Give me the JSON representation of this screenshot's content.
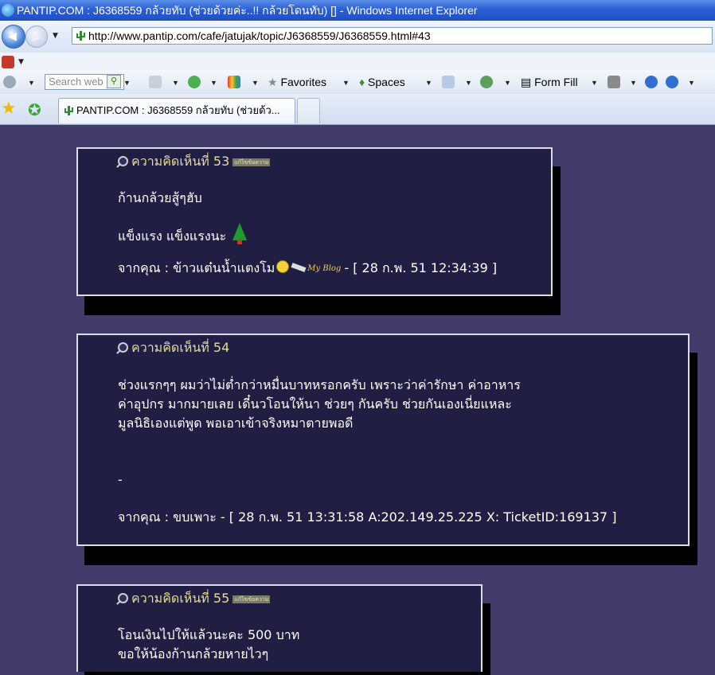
{
  "window": {
    "title": "PANTIP.COM : J6368559 กล้วยทับ (ช่วยด้วยค่ะ..!! กล้วยโดนทับ) [] - Windows Internet Explorer"
  },
  "address": {
    "url": "http://www.pantip.com/cafe/jatujak/topic/J6368559/J6368559.html#43"
  },
  "toolbar": {
    "search_placeholder": "Search web",
    "favorites": "Favorites",
    "spaces": "Spaces",
    "form_fill": "Form Fill"
  },
  "tabs": [
    {
      "label": "PANTIP.COM : J6368559 กล้วยทับ (ช่วยด้ว..."
    }
  ],
  "posts": [
    {
      "heading": "ความคิดเห็นที่ 53",
      "badge": "แก้ไขข้อความ",
      "lines": [
        "ก้านกล้วยสู้ๆฮับ",
        "แข็งแรง แข็งแรงนะ"
      ],
      "from_label": "จากคุณ : ข้าวแต๋นน้ำแตงโม",
      "blog_label": "My Blog",
      "timestamp": "- [ 28 ก.พ. 51 12:34:39 ]"
    },
    {
      "heading": "ความคิดเห็นที่ 54",
      "lines": [
        "ช่วงแรกๆๆ ผมว่าไม่ต่ำกว่าหมื่นบาทหรอกครับ เพราะว่าค่ารักษา ค่าอาหาร",
        "ค่าอุปกร มากมายเลย เดี๋นวโอนให้นา ช่วยๆ กันครับ ช่วยกันเองเนี่ยแหละ",
        "มูลนิธิเองแต่พูด พอเอาเข้าจริงหมาตายพอดี"
      ],
      "dash": "-",
      "footer": "จากคุณ : ขบเพาะ - [ 28 ก.พ. 51 13:31:58 A:202.149.25.225 X: TicketID:169137 ]"
    },
    {
      "heading": "ความคิดเห็นที่ 55",
      "badge": "แก้ไขข้อความ",
      "lines": [
        "โอนเงินไปให้แล้วนะคะ 500 บาท",
        "ขอให้น้องก้านกล้วยหายไวๆ"
      ]
    }
  ]
}
